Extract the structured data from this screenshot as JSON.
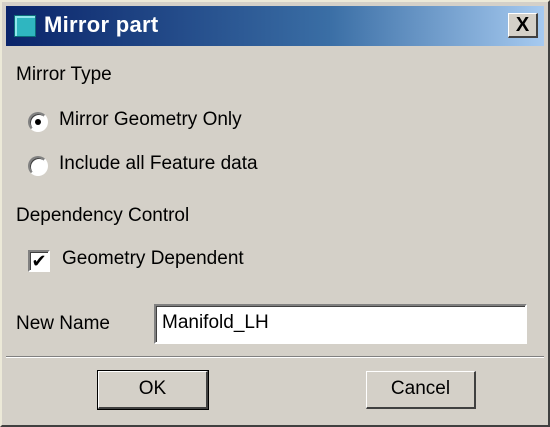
{
  "window": {
    "title": "Mirror part",
    "close_label": "X"
  },
  "mirror_type": {
    "label": "Mirror Type",
    "options": [
      {
        "label": "Mirror Geometry Only",
        "selected": true
      },
      {
        "label": "Include all Feature data",
        "selected": false
      }
    ]
  },
  "dependency": {
    "label": "Dependency Control",
    "checkbox_label": "Geometry Dependent",
    "checked": true,
    "check_glyph": "✔"
  },
  "new_name": {
    "label": "New Name",
    "value": "Manifold_LH"
  },
  "buttons": {
    "ok": "OK",
    "cancel": "Cancel"
  },
  "colors": {
    "title_bar": "#0a246a",
    "dialog_bg": "#d4d0c8",
    "icon": "#2fb6c0"
  }
}
